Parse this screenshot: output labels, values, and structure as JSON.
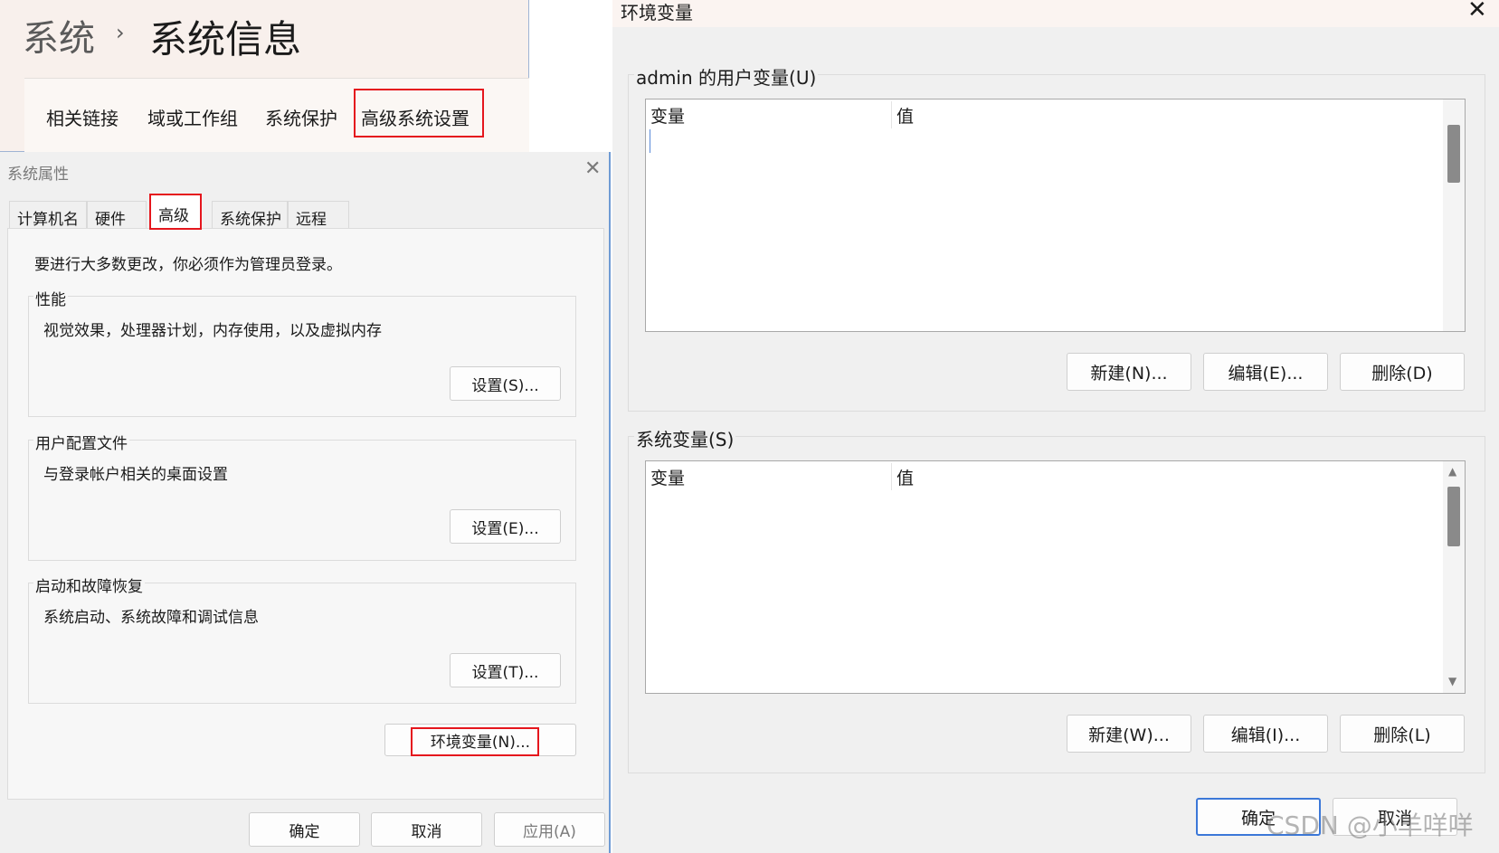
{
  "settings": {
    "breadcrumb_parent": "系统",
    "breadcrumb_sep": "›",
    "breadcrumb_current": "系统信息",
    "related_label": "相关链接",
    "related_links": [
      "域或工作组",
      "系统保护",
      "高级系统设置"
    ]
  },
  "sysprops": {
    "title": "系统属性",
    "close_glyph": "✕",
    "tabs": [
      "计算机名",
      "硬件",
      "高级",
      "系统保护",
      "远程"
    ],
    "admin_note": "要进行大多数更改，你必须作为管理员登录。",
    "groups": [
      {
        "title": "性能",
        "desc": "视觉效果，处理器计划，内存使用，以及虚拟内存",
        "button": "设置(S)..."
      },
      {
        "title": "用户配置文件",
        "desc": "与登录帐户相关的桌面设置",
        "button": "设置(E)..."
      },
      {
        "title": "启动和故障恢复",
        "desc": "系统启动、系统故障和调试信息",
        "button": "设置(T)..."
      }
    ],
    "env_button": "环境变量(N)...",
    "ok": "确定",
    "cancel": "取消",
    "apply": "应用(A)"
  },
  "envdlg": {
    "title": "环境变量",
    "close_glyph": "✕",
    "user_section": {
      "title": "admin 的用户变量(U)",
      "columns": [
        "变量",
        "值"
      ],
      "buttons": [
        "新建(N)...",
        "编辑(E)...",
        "删除(D)"
      ]
    },
    "system_section": {
      "title": "系统变量(S)",
      "columns": [
        "变量",
        "值"
      ],
      "buttons": [
        "新建(W)...",
        "编辑(I)...",
        "删除(L)"
      ]
    },
    "ok": "确定",
    "cancel": "取消"
  },
  "watermark": "CSDN @小羊咩咩",
  "colors": {
    "highlight": "#e5161d",
    "focus_border": "#3c78d8"
  }
}
